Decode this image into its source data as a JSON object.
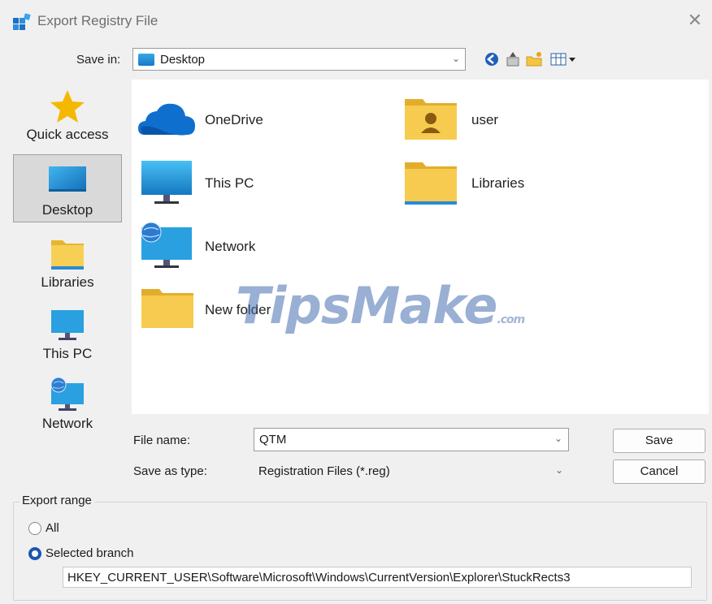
{
  "window": {
    "title": "Export Registry File",
    "close_glyph": "✕"
  },
  "save_in": {
    "label": "Save in:",
    "value": "Desktop"
  },
  "toolbar": {
    "icons": [
      "back-icon",
      "up-folder-icon",
      "new-folder-icon",
      "view-menu-icon"
    ]
  },
  "places": [
    {
      "label": "Quick access",
      "icon": "star-icon",
      "selected": false
    },
    {
      "label": "Desktop",
      "icon": "desktop-icon",
      "selected": true
    },
    {
      "label": "Libraries",
      "icon": "libraries-icon",
      "selected": false
    },
    {
      "label": "This PC",
      "icon": "pc-icon",
      "selected": false
    },
    {
      "label": "Network",
      "icon": "network-icon",
      "selected": false
    }
  ],
  "files": [
    {
      "label": "OneDrive",
      "icon": "onedrive-cloud-icon"
    },
    {
      "label": "user",
      "icon": "user-folder-icon"
    },
    {
      "label": "This PC",
      "icon": "pc-icon"
    },
    {
      "label": "Libraries",
      "icon": "libraries-folder-icon"
    },
    {
      "label": "Network",
      "icon": "network-icon"
    },
    {
      "label": "New folder",
      "icon": "folder-icon"
    }
  ],
  "watermark": {
    "text": "TipsMake",
    "suffix": ".com"
  },
  "file_name": {
    "label": "File name:",
    "value": "QTM"
  },
  "save_as_type": {
    "label": "Save as type:",
    "value": "Registration Files (*.reg)"
  },
  "buttons": {
    "save": "Save",
    "cancel": "Cancel"
  },
  "export_range": {
    "title": "Export range",
    "all_label": "All",
    "selected_label": "Selected branch",
    "selected": "Selected branch",
    "branch_value": "HKEY_CURRENT_USER\\Software\\Microsoft\\Windows\\CurrentVersion\\Explorer\\StuckRects3"
  },
  "colors": {
    "accent": "#1a56b0",
    "folder": "#f7c94b",
    "pc_screen": "#2aa0e0"
  }
}
